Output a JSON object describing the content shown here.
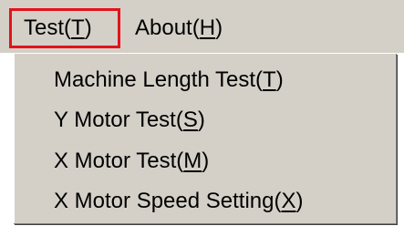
{
  "menubar": {
    "items": [
      {
        "label": "Test(",
        "mnemonic": "T",
        "suffix": ")"
      },
      {
        "label": "About(",
        "mnemonic": "H",
        "suffix": ")"
      }
    ]
  },
  "dropdown": {
    "items": [
      {
        "label": "Machine Length Test(",
        "mnemonic": "T",
        "suffix": ")"
      },
      {
        "label": "Y Motor Test(",
        "mnemonic": "S",
        "suffix": ")"
      },
      {
        "label": "X Motor Test(",
        "mnemonic": "M",
        "suffix": ")"
      },
      {
        "label": "X Motor Speed Setting(",
        "mnemonic": "X",
        "suffix": ")"
      }
    ]
  },
  "colors": {
    "menu_background": "#d4d0c8",
    "highlight_frame": "#e4121b"
  }
}
